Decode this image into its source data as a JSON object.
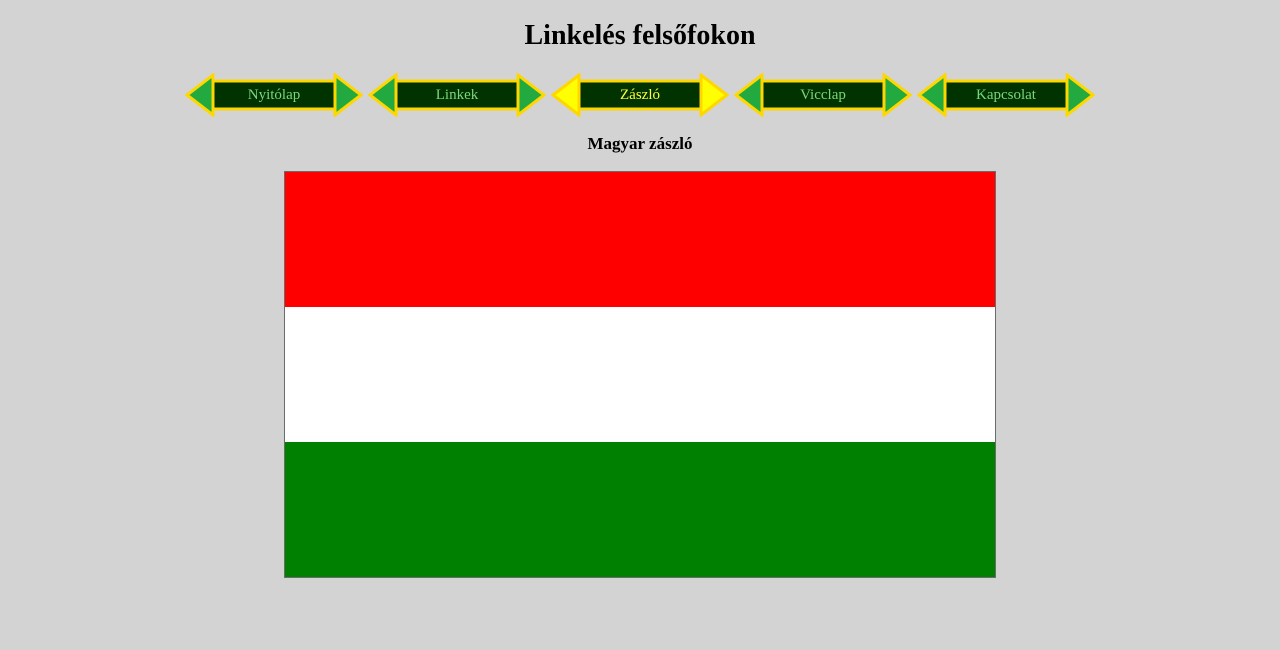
{
  "page": {
    "title": "Linkelés felsőfokon",
    "subtitle": "Magyar zászló"
  },
  "nav": {
    "items": [
      {
        "label": "Nyitólap",
        "active": false
      },
      {
        "label": "Linkek",
        "active": false
      },
      {
        "label": "Zászló",
        "active": true
      },
      {
        "label": "Vicclap",
        "active": false
      },
      {
        "label": "Kapcsolat",
        "active": false
      }
    ]
  },
  "colors": {
    "background": "#d3d3d3",
    "nav_arrow_green": "#22a93f",
    "nav_arrow_active": "#ffff00",
    "nav_frame": "#ffd700",
    "nav_label_bg": "#003300",
    "nav_label_text": "#7bd67b",
    "nav_label_text_active": "#ffff33",
    "flag_red": "#ff0000",
    "flag_white": "#ffffff",
    "flag_green": "#008000"
  },
  "flag": {
    "stripes": [
      "red",
      "white",
      "green"
    ]
  }
}
